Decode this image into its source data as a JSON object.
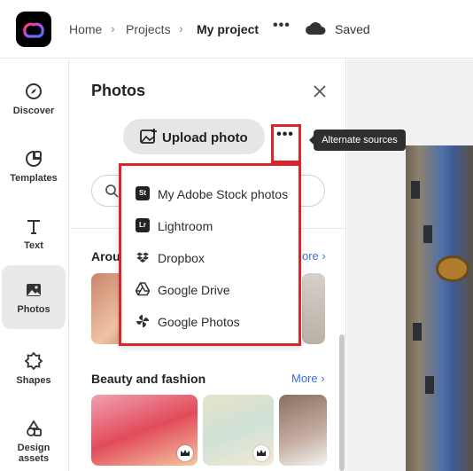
{
  "topbar": {
    "breadcrumb": [
      "Home",
      "Projects",
      "My project"
    ],
    "more_label": "•••",
    "status": "Saved"
  },
  "rail": {
    "items": [
      {
        "label": "Discover",
        "icon": "compass-icon"
      },
      {
        "label": "Templates",
        "icon": "templates-icon"
      },
      {
        "label": "Text",
        "icon": "text-icon"
      },
      {
        "label": "Photos",
        "icon": "photos-icon",
        "active": true
      },
      {
        "label": "Shapes",
        "icon": "shapes-icon"
      },
      {
        "label": "Design assets",
        "icon": "design-assets-icon"
      }
    ]
  },
  "panel": {
    "title": "Photos",
    "upload_label": "Upload photo",
    "alt_more_label": "•••",
    "sections": [
      {
        "title": "Arou",
        "more": "ore ›"
      },
      {
        "title": "Beauty and fashion",
        "more": "More ›"
      }
    ]
  },
  "tooltip": "Alternate sources",
  "dropdown": {
    "items": [
      {
        "label": "My Adobe Stock photos",
        "icon": "adobe-stock-icon",
        "badge": "St"
      },
      {
        "label": "Lightroom",
        "icon": "lightroom-icon",
        "badge": "Lr"
      },
      {
        "label": "Dropbox",
        "icon": "dropbox-icon"
      },
      {
        "label": "Google Drive",
        "icon": "google-drive-icon"
      },
      {
        "label": "Google Photos",
        "icon": "google-photos-icon"
      }
    ]
  },
  "colors": {
    "highlight": "#d9262c",
    "link": "#3b6fd6",
    "active_rail": "#e9e9e9"
  }
}
